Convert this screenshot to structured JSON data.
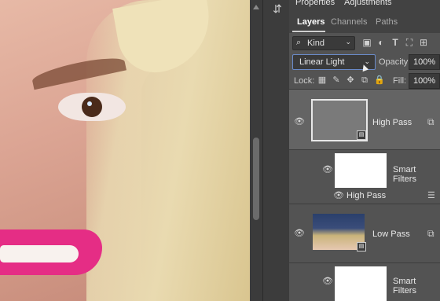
{
  "panel": {
    "top_tabs": [
      "Properties",
      "Adjustments"
    ],
    "tabs": [
      {
        "label": "Layers",
        "active": true
      },
      {
        "label": "Channels",
        "active": false
      },
      {
        "label": "Paths",
        "active": false
      }
    ],
    "filter": {
      "kind_label": "Kind",
      "icons": [
        "image-filter-icon",
        "adjustment-filter-icon",
        "type-filter-icon",
        "shape-filter-icon",
        "smartobject-filter-icon"
      ]
    },
    "blend_mode": "Linear Light",
    "opacity_label": "Opacity:",
    "opacity_value": "100%",
    "lock_label": "Lock:",
    "lock_icons": [
      "lock-transparent-icon",
      "lock-image-icon",
      "lock-position-icon",
      "lock-artboard-icon",
      "lock-all-icon"
    ],
    "fill_label": "Fill:",
    "fill_value": "100%"
  },
  "layers": [
    {
      "name": "High Pass",
      "kind": "smart-object",
      "selected": true
    },
    {
      "name": "Smart Filters",
      "kind": "filter-mask"
    },
    {
      "name": "High Pass",
      "kind": "smart-filter"
    },
    {
      "name": "Low Pass",
      "kind": "smart-object",
      "selected": false
    },
    {
      "name": "Smart Filters",
      "kind": "filter-mask"
    }
  ],
  "colors": {
    "panel_bg": "#535353",
    "selected_layer_bg": "#646464",
    "accent_border": "#6a8bc9",
    "lips": "#e52d85"
  }
}
